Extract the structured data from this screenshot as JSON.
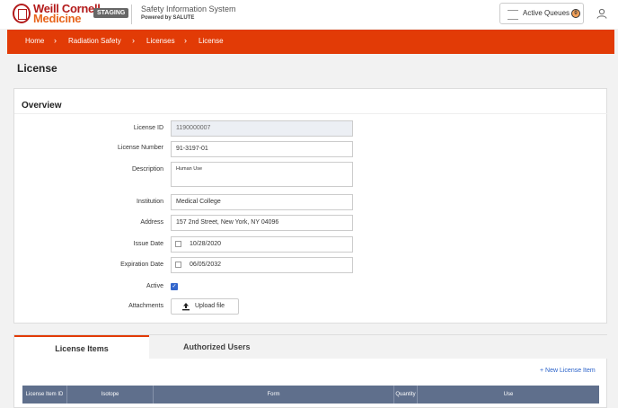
{
  "brand": {
    "line1": "Weill Cornell",
    "line2": "Medicine",
    "env_badge": "STAGING"
  },
  "system": {
    "title": "Safety Information System",
    "subtitle": "Powered by SALUTE"
  },
  "queues": {
    "label": "Active Queues",
    "count": "0"
  },
  "breadcrumbs": [
    "Home",
    "Radiation Safety",
    "Licenses",
    "License"
  ],
  "page": {
    "title": "License"
  },
  "overview": {
    "heading": "Overview",
    "fields": {
      "license_id": {
        "label": "License ID",
        "value": "1190000007"
      },
      "license_number": {
        "label": "License Number",
        "value": "91-3197-01"
      },
      "description": {
        "label": "Description",
        "value": "Human Use"
      },
      "institution": {
        "label": "Institution",
        "value": "Medical College"
      },
      "address": {
        "label": "Address",
        "value": "157 2nd Street, New York, NY 04096"
      },
      "issue_date": {
        "label": "Issue Date",
        "value": "10/28/2020"
      },
      "expiration_date": {
        "label": "Expiration Date",
        "value": "06/05/2032"
      },
      "active": {
        "label": "Active",
        "checked": true
      },
      "attachments": {
        "label": "Attachments",
        "button": "Upload file"
      }
    }
  },
  "tabs": [
    {
      "label": "License Items",
      "active": true
    },
    {
      "label": "Authorized Users",
      "active": false
    }
  ],
  "license_items": {
    "new_link": "+ New License Item",
    "columns": [
      "License Item ID",
      "Isotope",
      "Form",
      "Quantity",
      "Use"
    ]
  },
  "colors": {
    "brand_red": "#b31b1b",
    "breadcrumb_bg": "#e23b06",
    "table_header": "#5f6f8c",
    "link": "#2a62c9"
  }
}
